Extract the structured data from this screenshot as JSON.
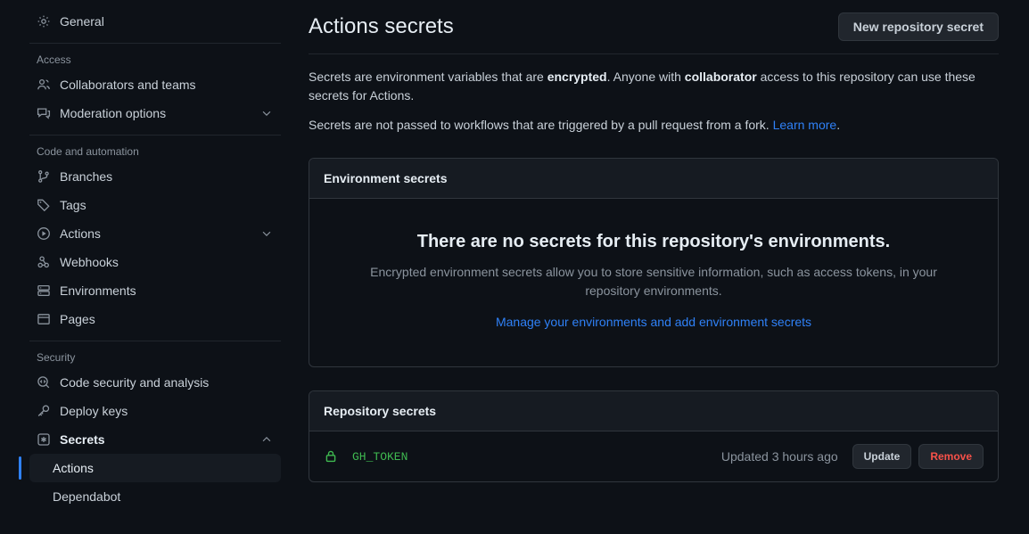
{
  "sidebar": {
    "groups": [
      {
        "label": null,
        "items": [
          {
            "label": "General",
            "icon": "gear-icon",
            "expandable": false
          }
        ]
      },
      {
        "label": "Access",
        "items": [
          {
            "label": "Collaborators and teams",
            "icon": "people-icon",
            "expandable": false
          },
          {
            "label": "Moderation options",
            "icon": "comment-discussion-icon",
            "expandable": true
          }
        ]
      },
      {
        "label": "Code and automation",
        "items": [
          {
            "label": "Branches",
            "icon": "git-branch-icon",
            "expandable": false
          },
          {
            "label": "Tags",
            "icon": "tag-icon",
            "expandable": false
          },
          {
            "label": "Actions",
            "icon": "play-icon",
            "expandable": true
          },
          {
            "label": "Webhooks",
            "icon": "webhook-icon",
            "expandable": false
          },
          {
            "label": "Environments",
            "icon": "server-icon",
            "expandable": false
          },
          {
            "label": "Pages",
            "icon": "browser-icon",
            "expandable": false
          }
        ]
      },
      {
        "label": "Security",
        "items": [
          {
            "label": "Code security and analysis",
            "icon": "codescan-icon",
            "expandable": false
          },
          {
            "label": "Deploy keys",
            "icon": "key-icon",
            "expandable": false
          },
          {
            "label": "Secrets",
            "icon": "asterisk-box-icon",
            "expandable": true,
            "expanded": true,
            "bold": true
          }
        ]
      }
    ],
    "secrets_children": [
      {
        "label": "Actions",
        "active": true
      },
      {
        "label": "Dependabot",
        "active": false
      }
    ]
  },
  "header": {
    "title": "Actions secrets",
    "new_secret_button": "New repository secret"
  },
  "description": {
    "para1_a": "Secrets are environment variables that are ",
    "para1_b": "encrypted",
    "para1_c": ". Anyone with ",
    "para1_d": "collaborator",
    "para1_e": " access to this repository can use these secrets for Actions.",
    "para2_a": "Secrets are not passed to workflows that are triggered by a pull request from a fork. ",
    "para2_link": "Learn more",
    "para2_b": "."
  },
  "environment_secrets": {
    "panel_title": "Environment secrets",
    "empty_title": "There are no secrets for this repository's environments.",
    "empty_body": "Encrypted environment secrets allow you to store sensitive information, such as access tokens, in your repository environments.",
    "cta": "Manage your environments and add environment secrets"
  },
  "repository_secrets": {
    "panel_title": "Repository secrets",
    "rows": [
      {
        "name": "GH_TOKEN",
        "updated": "Updated 3 hours ago",
        "update_label": "Update",
        "remove_label": "Remove"
      }
    ]
  },
  "colors": {
    "page_bg": "#0d1117",
    "panel_header_bg": "#161b22",
    "border": "#30363d",
    "accent_blue": "#2f81f7",
    "secret_green": "#3fb950",
    "danger_red": "#f85149",
    "muted_text": "#8b949e"
  }
}
